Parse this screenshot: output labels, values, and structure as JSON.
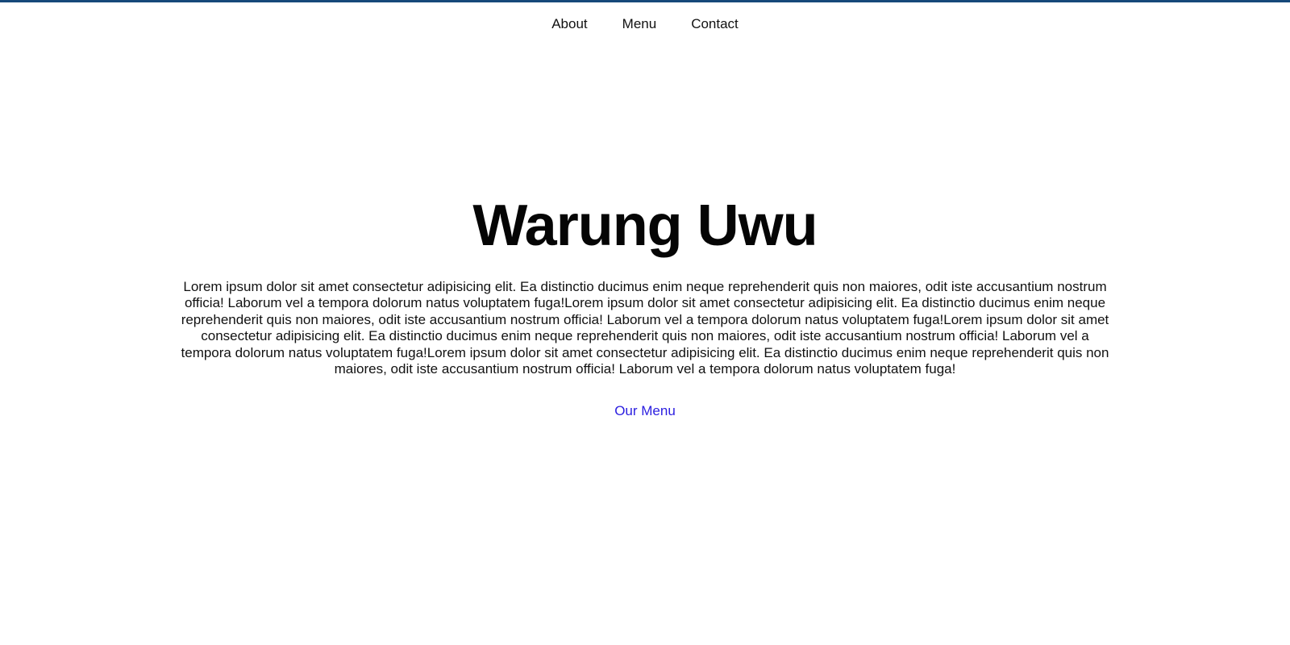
{
  "nav": {
    "items": [
      {
        "label": "About"
      },
      {
        "label": "Menu"
      },
      {
        "label": "Contact"
      }
    ]
  },
  "hero": {
    "title": "Warung Uwu",
    "description": "Lorem ipsum dolor sit amet consectetur adipisicing elit. Ea distinctio ducimus enim neque reprehenderit quis non maiores, odit iste accusantium nostrum officia! Laborum vel a tempora dolorum natus voluptatem fuga!Lorem ipsum dolor sit amet consectetur adipisicing elit. Ea distinctio ducimus enim neque reprehenderit quis non maiores, odit iste accusantium nostrum officia! Laborum vel a tempora dolorum natus voluptatem fuga!Lorem ipsum dolor sit amet consectetur adipisicing elit. Ea distinctio ducimus enim neque reprehenderit quis non maiores, odit iste accusantium nostrum officia! Laborum vel a tempora dolorum natus voluptatem fuga!Lorem ipsum dolor sit amet consectetur adipisicing elit. Ea distinctio ducimus enim neque reprehenderit quis non maiores, odit iste accusantium nostrum officia! Laborum vel a tempora dolorum natus voluptatem fuga!",
    "cta_label": "Our Menu"
  },
  "colors": {
    "top_border": "#16497a",
    "link": "#2b1ee0",
    "text": "#111111"
  }
}
